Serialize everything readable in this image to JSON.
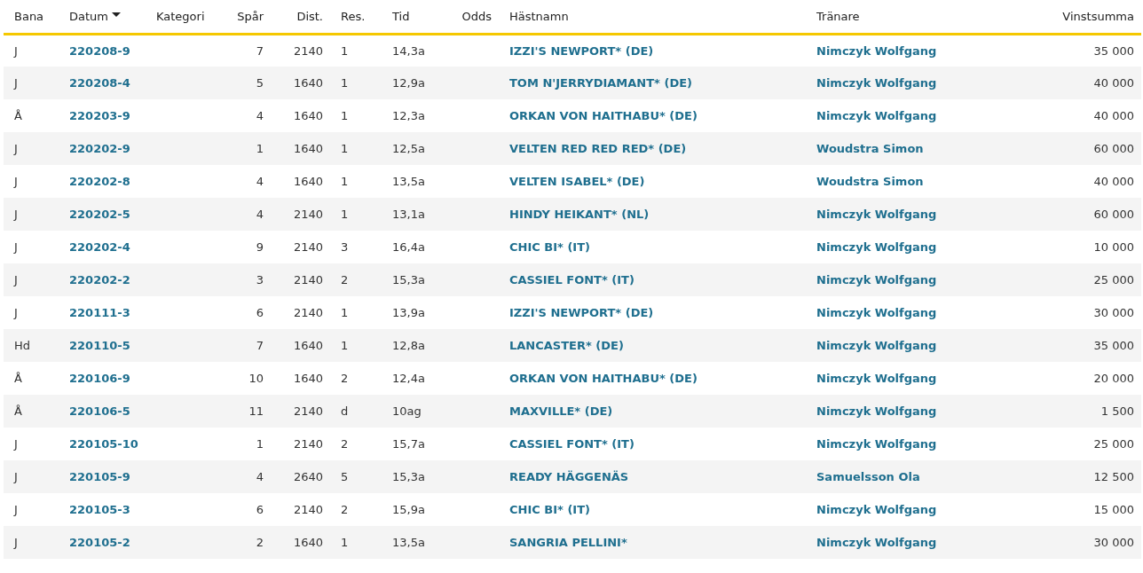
{
  "table": {
    "columns": [
      {
        "label": "Bana",
        "kind": "text"
      },
      {
        "label": "Datum",
        "kind": "link",
        "sorted": true
      },
      {
        "label": "Kategori",
        "kind": "text"
      },
      {
        "label": "Spår",
        "kind": "number"
      },
      {
        "label": "Dist.",
        "kind": "number"
      },
      {
        "label": "Res.",
        "kind": "text"
      },
      {
        "label": "Tid",
        "kind": "text"
      },
      {
        "label": "Odds",
        "kind": "number"
      },
      {
        "label": "Hästnamn",
        "kind": "link"
      },
      {
        "label": "Tränare",
        "kind": "link"
      },
      {
        "label": "Vinstsumma",
        "kind": "number"
      }
    ],
    "rows": [
      {
        "bana": "J",
        "datum": "220208-9",
        "spar": "7",
        "dist": "2140",
        "res": "1",
        "tid": "14,3a",
        "hastnamn": "IZZI'S NEWPORT* (DE)",
        "tranare": "Nimczyk Wolfgang",
        "vinstsumma": "35 000"
      },
      {
        "bana": "J",
        "datum": "220208-4",
        "spar": "5",
        "dist": "1640",
        "res": "1",
        "tid": "12,9a",
        "hastnamn": "TOM N'JERRYDIAMANT* (DE)",
        "tranare": "Nimczyk Wolfgang",
        "vinstsumma": "40 000"
      },
      {
        "bana": "Å",
        "datum": "220203-9",
        "spar": "4",
        "dist": "1640",
        "res": "1",
        "tid": "12,3a",
        "hastnamn": "ORKAN VON HAITHABU* (DE)",
        "tranare": "Nimczyk Wolfgang",
        "vinstsumma": "40 000"
      },
      {
        "bana": "J",
        "datum": "220202-9",
        "spar": "1",
        "dist": "1640",
        "res": "1",
        "tid": "12,5a",
        "hastnamn": "VELTEN RED RED RED* (DE)",
        "tranare": "Woudstra Simon",
        "vinstsumma": "60 000"
      },
      {
        "bana": "J",
        "datum": "220202-8",
        "spar": "4",
        "dist": "1640",
        "res": "1",
        "tid": "13,5a",
        "hastnamn": "VELTEN ISABEL* (DE)",
        "tranare": "Woudstra Simon",
        "vinstsumma": "40 000"
      },
      {
        "bana": "J",
        "datum": "220202-5",
        "spar": "4",
        "dist": "2140",
        "res": "1",
        "tid": "13,1a",
        "hastnamn": "HINDY HEIKANT* (NL)",
        "tranare": "Nimczyk Wolfgang",
        "vinstsumma": "60 000"
      },
      {
        "bana": "J",
        "datum": "220202-4",
        "spar": "9",
        "dist": "2140",
        "res": "3",
        "tid": "16,4a",
        "hastnamn": "CHIC BI* (IT)",
        "tranare": "Nimczyk Wolfgang",
        "vinstsumma": "10 000"
      },
      {
        "bana": "J",
        "datum": "220202-2",
        "spar": "3",
        "dist": "2140",
        "res": "2",
        "tid": "15,3a",
        "hastnamn": "CASSIEL FONT* (IT)",
        "tranare": "Nimczyk Wolfgang",
        "vinstsumma": "25 000"
      },
      {
        "bana": "J",
        "datum": "220111-3",
        "spar": "6",
        "dist": "2140",
        "res": "1",
        "tid": "13,9a",
        "hastnamn": "IZZI'S NEWPORT* (DE)",
        "tranare": "Nimczyk Wolfgang",
        "vinstsumma": "30 000"
      },
      {
        "bana": "Hd",
        "datum": "220110-5",
        "spar": "7",
        "dist": "1640",
        "res": "1",
        "tid": "12,8a",
        "hastnamn": "LANCASTER* (DE)",
        "tranare": "Nimczyk Wolfgang",
        "vinstsumma": "35 000"
      },
      {
        "bana": "Å",
        "datum": "220106-9",
        "spar": "10",
        "dist": "1640",
        "res": "2",
        "tid": "12,4a",
        "hastnamn": "ORKAN VON HAITHABU* (DE)",
        "tranare": "Nimczyk Wolfgang",
        "vinstsumma": "20 000"
      },
      {
        "bana": "Å",
        "datum": "220106-5",
        "spar": "11",
        "dist": "2140",
        "res": "d",
        "tid": "10ag",
        "hastnamn": "MAXVILLE* (DE)",
        "tranare": "Nimczyk Wolfgang",
        "vinstsumma": "1 500"
      },
      {
        "bana": "J",
        "datum": "220105-10",
        "spar": "1",
        "dist": "2140",
        "res": "2",
        "tid": "15,7a",
        "hastnamn": "CASSIEL FONT* (IT)",
        "tranare": "Nimczyk Wolfgang",
        "vinstsumma": "25 000"
      },
      {
        "bana": "J",
        "datum": "220105-9",
        "spar": "4",
        "dist": "2640",
        "res": "5",
        "tid": "15,3a",
        "hastnamn": "READY HÄGGENÄS",
        "tranare": "Samuelsson Ola",
        "vinstsumma": "12 500"
      },
      {
        "bana": "J",
        "datum": "220105-3",
        "spar": "6",
        "dist": "2140",
        "res": "2",
        "tid": "15,9a",
        "hastnamn": "CHIC BI* (IT)",
        "tranare": "Nimczyk Wolfgang",
        "vinstsumma": "15 000"
      },
      {
        "bana": "J",
        "datum": "220105-2",
        "spar": "2",
        "dist": "1640",
        "res": "1",
        "tid": "13,5a",
        "hastnamn": "SANGRIA PELLINI*",
        "tranare": "Nimczyk Wolfgang",
        "vinstsumma": "30 000"
      }
    ]
  }
}
